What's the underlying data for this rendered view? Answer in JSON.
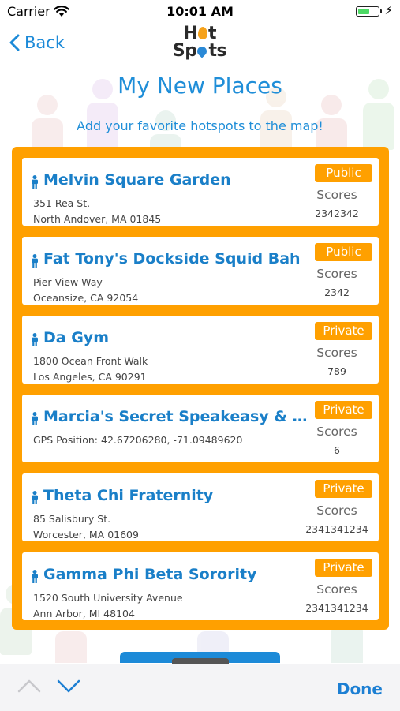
{
  "status_bar": {
    "carrier": "Carrier",
    "time": "10:01 AM",
    "battery_fraction": 0.55
  },
  "nav": {
    "back_label": "Back",
    "logo_top": "H",
    "logo_top_end": "t",
    "logo_bottom": "Sp",
    "logo_bottom_end": "ts"
  },
  "page": {
    "title": "My New Places",
    "subtitle": "Add your favorite hotspots to the map!"
  },
  "places": [
    {
      "name": "Melvin Square Garden",
      "line1": "351 Rea St.",
      "line2": "North Andover, MA 01845",
      "visibility": "Public",
      "scores_label": "Scores",
      "score": "2342342"
    },
    {
      "name": "Fat Tony's Dockside Squid Bah",
      "line1": "Pier View Way",
      "line2": "Oceansize, CA 92054",
      "visibility": "Public",
      "scores_label": "Scores",
      "score": "2342"
    },
    {
      "name": "Da Gym",
      "line1": "1800 Ocean Front Walk",
      "line2": "Los Angeles, CA 90291",
      "visibility": "Private",
      "scores_label": "Scores",
      "score": "789"
    },
    {
      "name": "Marcia's Secret Speakeasy & Hookah Lounge",
      "line1": "GPS Position: 42.67206280, -71.09489620",
      "line2": "",
      "visibility": "Private",
      "scores_label": "Scores",
      "score": "6"
    },
    {
      "name": "Theta Chi Fraternity",
      "line1": "85 Salisbury St.",
      "line2": "Worcester, MA 01609",
      "visibility": "Private",
      "scores_label": "Scores",
      "score": "2341341234"
    },
    {
      "name": "Gamma Phi Beta Sorority",
      "line1": "1520 South University Avenue",
      "line2": "Ann Arbor, MI 48104",
      "visibility": "Private",
      "scores_label": "Scores",
      "score": "2341341234"
    }
  ],
  "toolbar": {
    "done_label": "Done"
  },
  "colors": {
    "accent_blue": "#1f8ed8",
    "panel_orange": "#ffa000",
    "name_blue": "#1a7fc8"
  },
  "icons": {
    "back": "chevron-left-icon",
    "prev": "chevron-up-icon",
    "next": "chevron-down-icon",
    "place": "person-icon",
    "wifi": "wifi-icon",
    "battery": "battery-icon",
    "charging": "bolt-icon"
  }
}
